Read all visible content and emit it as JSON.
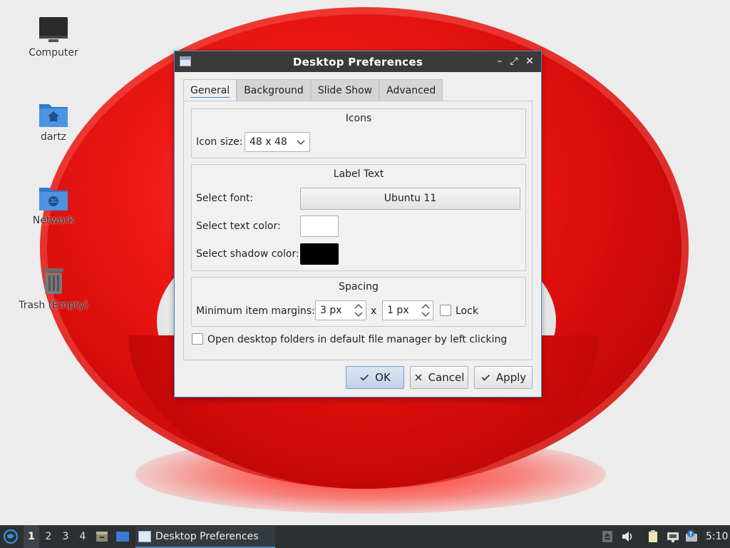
{
  "desktop": {
    "icons": [
      {
        "label": "Computer",
        "icon": "computer-icon"
      },
      {
        "label": "dartz",
        "icon": "home-folder-icon"
      },
      {
        "label": "Network",
        "icon": "network-folder-icon"
      },
      {
        "label": "Trash (Empty)",
        "icon": "trash-icon"
      }
    ]
  },
  "dialog": {
    "title": "Desktop Preferences",
    "tabs": [
      {
        "label": "General",
        "active": true
      },
      {
        "label": "Background",
        "active": false
      },
      {
        "label": "Slide Show",
        "active": false
      },
      {
        "label": "Advanced",
        "active": false
      }
    ],
    "icons_group": {
      "title": "Icons",
      "icon_size_label": "Icon size:",
      "icon_size_value": "48 x 48"
    },
    "label_text_group": {
      "title": "Label Text",
      "font_label": "Select font:",
      "font_value": "Ubuntu 11",
      "text_color_label": "Select text color:",
      "text_color": "#ffffff",
      "shadow_color_label": "Select shadow color:",
      "shadow_color": "#000000"
    },
    "spacing_group": {
      "title": "Spacing",
      "margins_label": "Minimum item margins:",
      "margin_x": "3 px",
      "separator": "x",
      "margin_y": "1 px",
      "lock_label": "Lock",
      "lock_checked": false
    },
    "open_folders_label": "Open desktop folders in default file manager by left clicking",
    "open_folders_checked": false,
    "buttons": {
      "ok": "OK",
      "cancel": "Cancel",
      "apply": "Apply"
    }
  },
  "taskbar": {
    "workspaces": [
      "1",
      "2",
      "3",
      "4"
    ],
    "active_workspace": "1",
    "task_title": "Desktop Preferences",
    "clock": "5:10"
  },
  "colors": {
    "accent": "#4a86c8",
    "taskbar_bg": "#2c3033",
    "titlebar_bg": "#3a3a3a",
    "wallpaper_red": "#d40b0b"
  }
}
